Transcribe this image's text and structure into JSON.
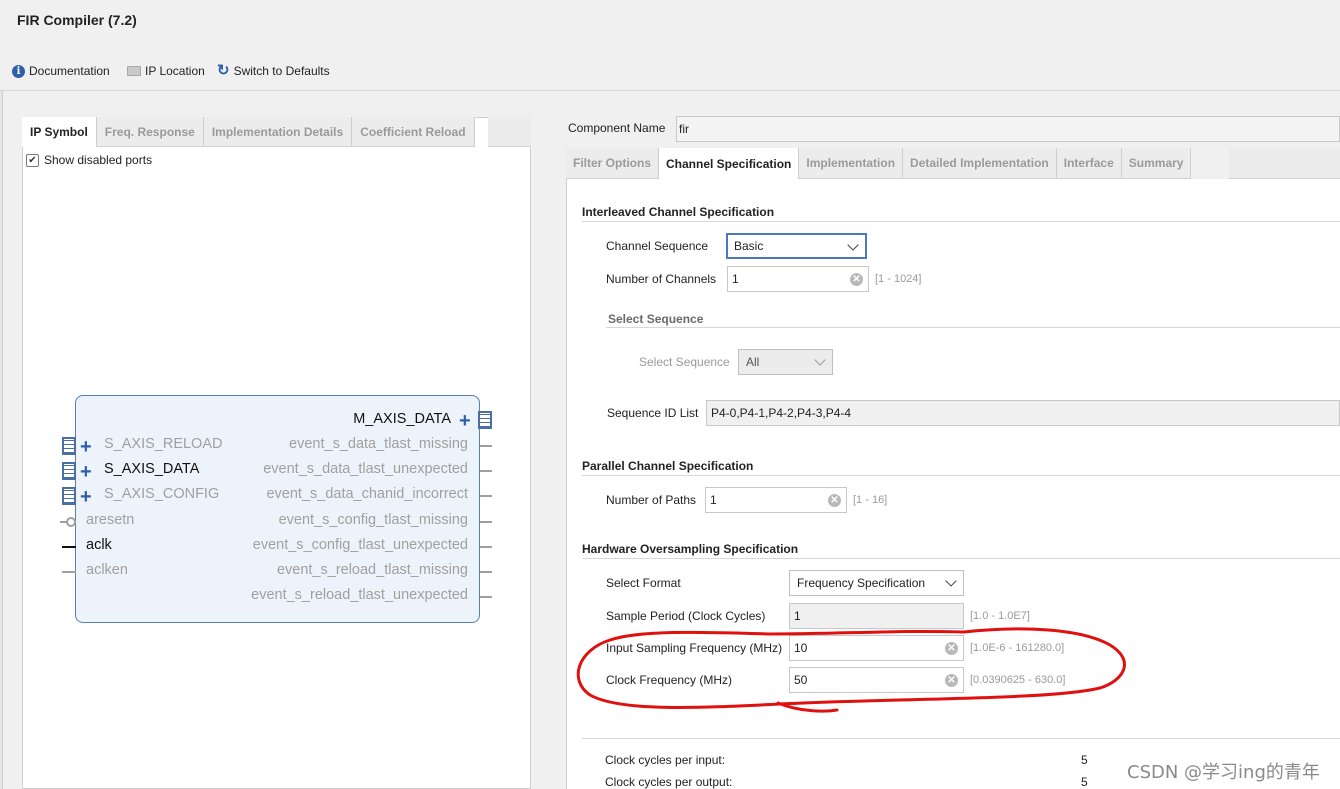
{
  "window": {
    "title": "FIR Compiler (7.2)"
  },
  "toolbar": {
    "documentation": "Documentation",
    "ip_location": "IP Location",
    "switch_defaults": "Switch to Defaults"
  },
  "left_tabs": [
    "IP Symbol",
    "Freq. Response",
    "Implementation Details",
    "Coefficient Reload"
  ],
  "show_disabled_ports": {
    "label": "Show disabled ports",
    "checked": true
  },
  "ip_symbol": {
    "output_bus": "M_AXIS_DATA",
    "input_ports": [
      {
        "label": "S_AXIS_RELOAD",
        "enabled": false
      },
      {
        "label": "S_AXIS_DATA",
        "enabled": true
      },
      {
        "label": "S_AXIS_CONFIG",
        "enabled": false
      },
      {
        "label": "aresetn",
        "enabled": false
      },
      {
        "label": "aclk",
        "enabled": true
      },
      {
        "label": "aclken",
        "enabled": false
      }
    ],
    "output_ports": [
      "event_s_data_tlast_missing",
      "event_s_data_tlast_unexpected",
      "event_s_data_chanid_incorrect",
      "event_s_config_tlast_missing",
      "event_s_config_tlast_unexpected",
      "event_s_reload_tlast_missing",
      "event_s_reload_tlast_unexpected"
    ]
  },
  "component_name": {
    "label": "Component Name",
    "value": "fir"
  },
  "right_tabs": [
    "Filter Options",
    "Channel Specification",
    "Implementation",
    "Detailed Implementation",
    "Interface",
    "Summary"
  ],
  "interleaved": {
    "title": "Interleaved Channel Specification",
    "channel_sequence": {
      "label": "Channel Sequence",
      "value": "Basic"
    },
    "num_channels": {
      "label": "Number of Channels",
      "value": "1",
      "range": "[1 - 1024]"
    },
    "select_sequence_group": "Select Sequence",
    "select_sequence": {
      "label": "Select Sequence",
      "value": "All"
    },
    "sequence_id_list": {
      "label": "Sequence ID List",
      "value": "P4-0,P4-1,P4-2,P4-3,P4-4"
    }
  },
  "parallel": {
    "title": "Parallel Channel Specification",
    "num_paths": {
      "label": "Number of Paths",
      "value": "1",
      "range": "[1 - 16]"
    }
  },
  "hardware": {
    "title": "Hardware Oversampling Specification",
    "select_format": {
      "label": "Select Format",
      "value": "Frequency Specification"
    },
    "sample_period": {
      "label": "Sample Period (Clock Cycles)",
      "value": "1",
      "range": "[1.0 - 1.0E7]"
    },
    "input_freq": {
      "label": "Input Sampling Frequency (MHz)",
      "value": "10",
      "range": "[1.0E-6 - 161280.0]"
    },
    "clock_freq": {
      "label": "Clock Frequency (MHz)",
      "value": "50",
      "range": "[0.0390625 - 630.0]"
    }
  },
  "summary": [
    {
      "label": "Clock cycles per input:",
      "value": "5"
    },
    {
      "label": "Clock cycles per output:",
      "value": "5"
    }
  ],
  "watermark": "CSDN @学习ing的青年",
  "colors": {
    "accent": "#2f5fa8",
    "annotation": "#e01010",
    "block_fill": "#edf3fa"
  }
}
